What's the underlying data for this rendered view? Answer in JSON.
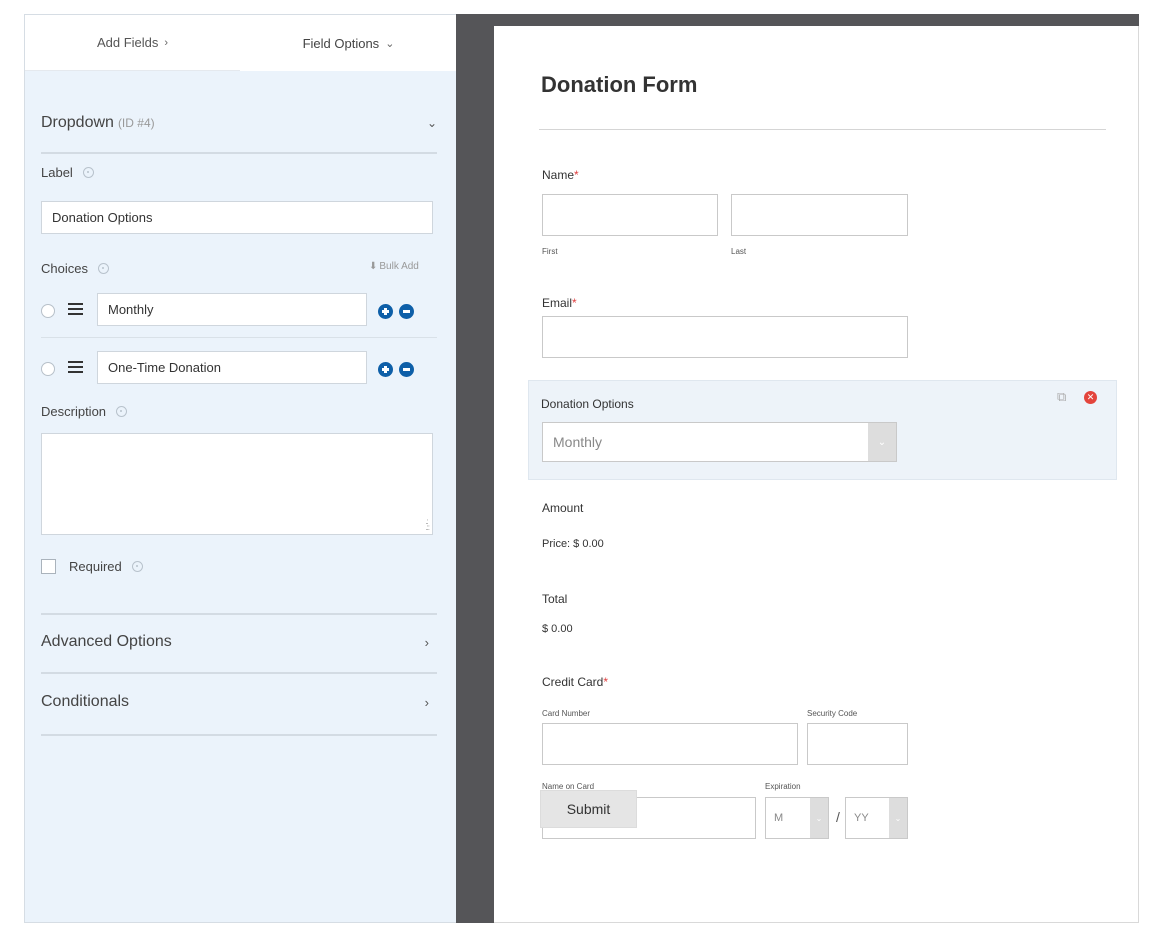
{
  "tabs": {
    "add_fields": "Add Fields",
    "add_fields_chevron": "›",
    "field_options": "Field Options",
    "field_options_chevron": "⌄"
  },
  "field_options": {
    "field_type": "Dropdown",
    "field_id": "(ID #4)",
    "label_title": "Label",
    "label_value": "Donation Options",
    "choices_title": "Choices",
    "bulk_add": "Bulk Add",
    "choices": [
      {
        "value": "Monthly"
      },
      {
        "value": "One-Time Donation"
      }
    ],
    "description_title": "Description",
    "description_value": "",
    "required_label": "Required",
    "required_checked": false,
    "advanced_options": "Advanced Options",
    "conditionals": "Conditionals"
  },
  "form": {
    "title": "Donation Form",
    "name_label": "Name",
    "required_star": "*",
    "first_sublabel": "First",
    "last_sublabel": "Last",
    "email_label": "Email",
    "donation_label": "Donation Options",
    "donation_selected": "Monthly",
    "amount_label": "Amount",
    "amount_price": "Price: $ 0.00",
    "total_label": "Total",
    "total_value": "$ 0.00",
    "cc_label": "Credit Card",
    "card_number_label": "Card Number",
    "security_code_label": "Security Code",
    "name_on_card_label": "Name on Card",
    "expiration_label": "Expiration",
    "exp_month": "M",
    "exp_slash": "/",
    "exp_year": "YY",
    "submit": "Submit"
  },
  "colors": {
    "panel_bg": "#ebf3fb",
    "accent_blue": "#0e5fa8",
    "required_red": "#e04040",
    "divider": "#555558"
  }
}
